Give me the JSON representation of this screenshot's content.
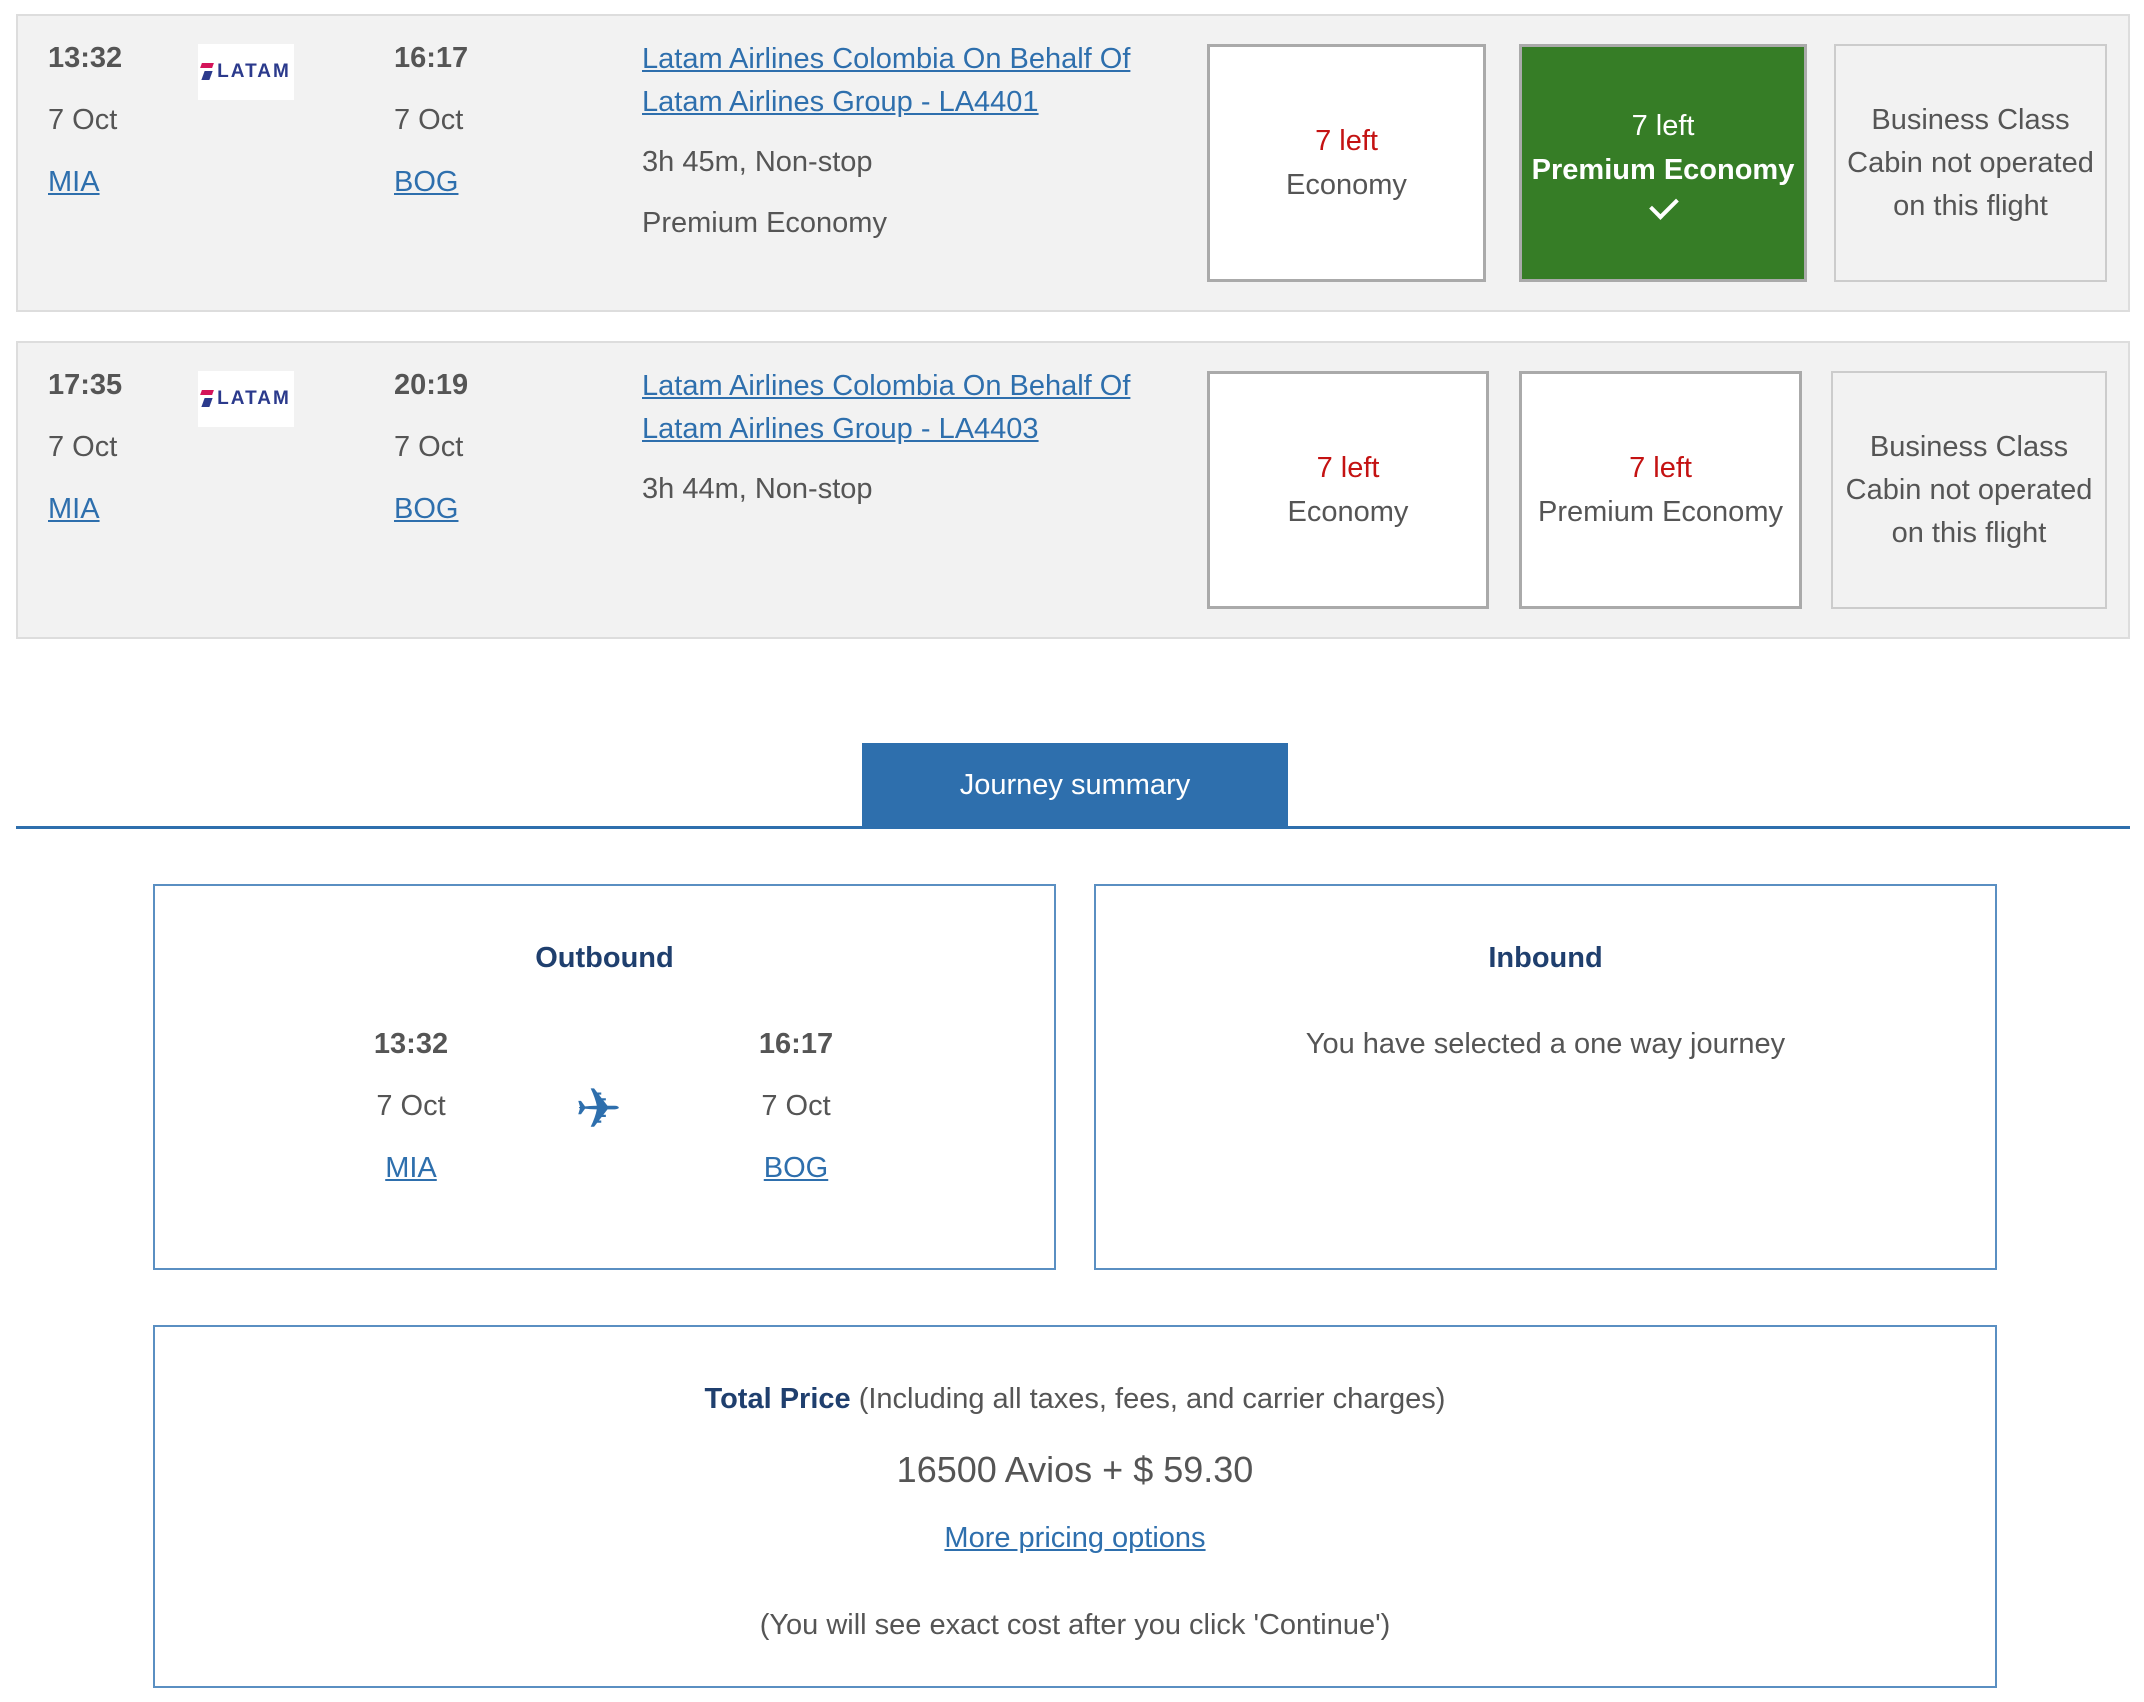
{
  "flights": [
    {
      "depart_time": "13:32",
      "depart_date": "7 Oct",
      "depart_airport": "MIA",
      "airline_logo_text": "LATAM",
      "arrive_time": "16:17",
      "arrive_date": "7 Oct",
      "arrive_airport": "BOG",
      "carrier_line1": "Latam Airlines Colombia On Behalf Of",
      "carrier_line2": "Latam Airlines Group - LA4401",
      "duration": "3h 45m, Non-stop",
      "selected_cabin": "Premium Economy",
      "cabins": [
        {
          "seats_left": "7 left",
          "name": "Economy"
        },
        {
          "seats_left": "7 left",
          "name": "Premium Economy",
          "selected": true
        },
        {
          "line1": "Business Class",
          "line2": "Cabin not operated",
          "line3": "on this flight"
        }
      ]
    },
    {
      "depart_time": "17:35",
      "depart_date": "7 Oct",
      "depart_airport": "MIA",
      "airline_logo_text": "LATAM",
      "arrive_time": "20:19",
      "arrive_date": "7 Oct",
      "arrive_airport": "BOG",
      "carrier_line1": "Latam Airlines Colombia On Behalf Of",
      "carrier_line2": "Latam Airlines Group - LA4403",
      "duration": "3h 44m, Non-stop",
      "cabins": [
        {
          "seats_left": "7 left",
          "name": "Economy"
        },
        {
          "seats_left": "7 left",
          "name": "Premium Economy"
        },
        {
          "line1": "Business Class",
          "line2": "Cabin not operated",
          "line3": "on this flight"
        }
      ]
    }
  ],
  "summary": {
    "tab_label": "Journey summary",
    "outbound": {
      "title": "Outbound",
      "depart_time": "13:32",
      "depart_date": "7 Oct",
      "depart_airport": "MIA",
      "arrive_time": "16:17",
      "arrive_date": "7 Oct",
      "arrive_airport": "BOG",
      "icon": "plane-icon"
    },
    "inbound": {
      "title": "Inbound",
      "message": "You have selected a one way journey"
    },
    "price": {
      "label": "Total Price",
      "label_note": " (Including all taxes, fees, and carrier charges)",
      "amount": "16500 Avios + $ 59.30",
      "more_link": "More pricing options",
      "note": "(You will see exact cost after you click 'Continue')"
    }
  },
  "colors": {
    "accent": "#2e6fad",
    "selected": "#367d26",
    "seats_left": "#c41212",
    "heading": "#1f3f6e"
  }
}
